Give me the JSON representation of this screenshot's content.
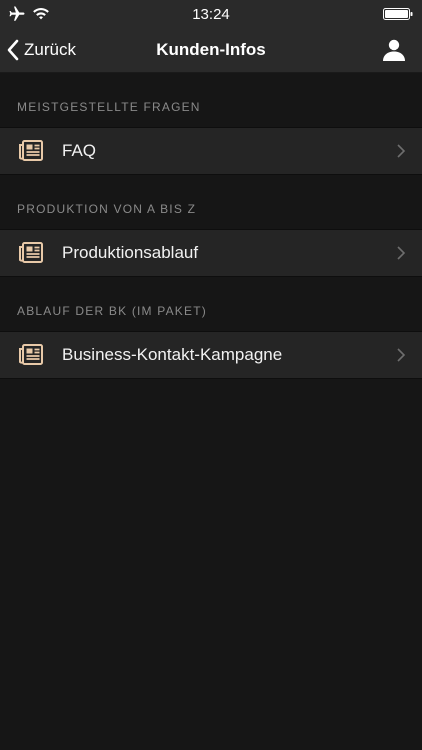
{
  "status_bar": {
    "time": "13:24",
    "icons": [
      "airplane-icon",
      "wifi-icon",
      "battery-icon"
    ]
  },
  "nav": {
    "back_label": "Zurück",
    "title": "Kunden-Infos",
    "right_icon": "user-icon"
  },
  "sections": [
    {
      "header": "MEISTGESTELLTE FRAGEN",
      "item_label": "FAQ",
      "item_icon": "newspaper-icon"
    },
    {
      "header": "PRODUKTION VON A BIS Z",
      "item_label": "Produktionsablauf",
      "item_icon": "newspaper-icon"
    },
    {
      "header": "ABLAUF DER BK (IM PAKET)",
      "item_label": "Business-Kontakt-Kampagne",
      "item_icon": "newspaper-icon"
    }
  ],
  "colors": {
    "background": "#161616",
    "bar": "#2a2a2a",
    "row": "#252525",
    "section_header_text": "#8a8a8a",
    "icon_accent": "#e8c9a8"
  }
}
